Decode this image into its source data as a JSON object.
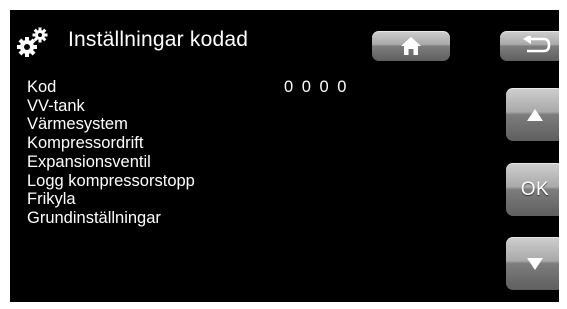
{
  "header": {
    "title": "Inställningar kodad",
    "settings_icon": "gears-icon",
    "home_icon": "home-icon",
    "back_icon": "back-arrow-icon"
  },
  "menu": {
    "items": [
      "Kod",
      "VV-tank",
      "Värmesystem",
      "Kompressordrift",
      "Expansionsventil",
      "Logg kompressorstopp",
      "Frikyla",
      "Grundinställningar"
    ],
    "code_value": "0 0 0 0"
  },
  "nav": {
    "up_icon": "arrow-up-icon",
    "ok_label": "OK",
    "down_icon": "arrow-down-icon"
  },
  "colors": {
    "background": "#000000",
    "text": "#ffffff",
    "button_top": "#cfcfcf",
    "button_bottom": "#5f5f5f"
  }
}
